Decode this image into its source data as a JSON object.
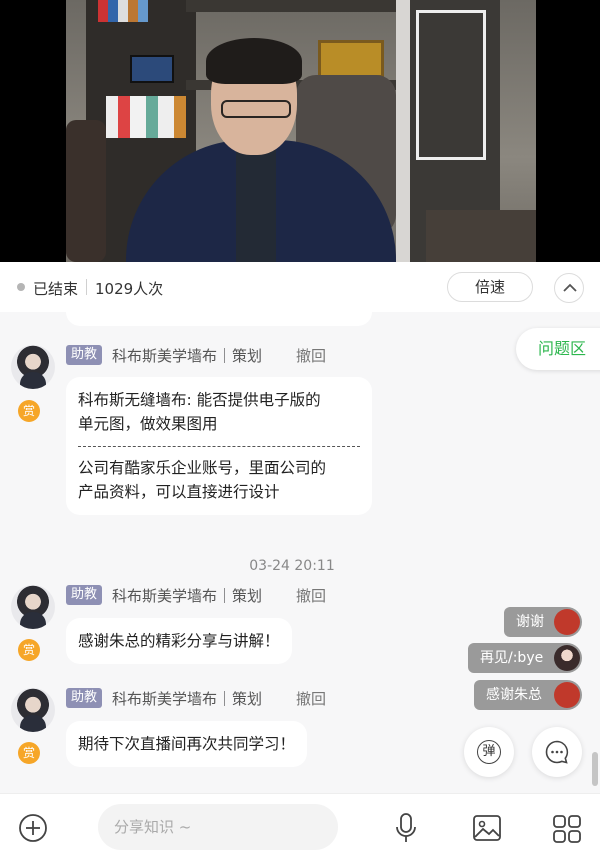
{
  "status": {
    "state": "已结束",
    "views": "1029人次",
    "speed_label": "倍速"
  },
  "qa_tab": "问题区",
  "messages": [
    {
      "badge": "助教",
      "sender": "科布斯美学墙布｜策划",
      "revoke": "撤回",
      "reward": "赏",
      "question": [
        "科布斯无缝墙布: 能否提供电子版的",
        "单元图，做效果图用"
      ],
      "answer": [
        "公司有酷家乐企业账号，里面公司的",
        "产品资料，可以直接进行设计"
      ]
    },
    {
      "badge": "助教",
      "sender": "科布斯美学墙布｜策划",
      "revoke": "撤回",
      "reward": "赏",
      "text": "感谢朱总的精彩分享与讲解！"
    },
    {
      "badge": "助教",
      "sender": "科布斯美学墙布｜策划",
      "revoke": "撤回",
      "reward": "赏",
      "text": "期待下次直播间再次共同学习！"
    }
  ],
  "timestamp": "03-24 20:11",
  "danmu": [
    "谢谢",
    "再见/:bye",
    "感谢朱总"
  ],
  "buttons": {
    "danmu_toggle": "弹"
  },
  "bottom_bar": {
    "input_placeholder": "分享知识 ~"
  },
  "colors": {
    "accent_green": "#2db64e",
    "badge_purple": "#8e90b4",
    "reward_orange": "#f6a628"
  }
}
